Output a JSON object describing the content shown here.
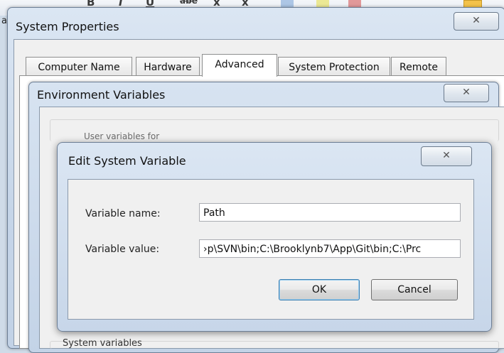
{
  "background": {
    "left_letter": "a",
    "toolbar_glyphs": [
      "B",
      "I",
      "U",
      "abe",
      "x",
      "x"
    ],
    "bottom_text": "System variables"
  },
  "system_properties": {
    "title": "System Properties",
    "close_glyph": "✕",
    "tabs": [
      {
        "label": "Computer Name",
        "active": false
      },
      {
        "label": "Hardware",
        "active": false
      },
      {
        "label": "Advanced",
        "active": true
      },
      {
        "label": "System Protection",
        "active": false
      },
      {
        "label": "Remote",
        "active": false
      }
    ]
  },
  "environment_variables": {
    "title": "Environment Variables",
    "close_glyph": "✕",
    "user_vars_label": "User variables for"
  },
  "edit_system_variable": {
    "title": "Edit System Variable",
    "close_glyph": "✕",
    "variable_name_label": "Variable name:",
    "variable_name_value": "Path",
    "variable_value_label": "Variable value:",
    "variable_value_value": "›p\\SVN\\bin;C:\\Brooklynb7\\App\\Git\\bin;C:\\Prc",
    "ok_label": "OK",
    "cancel_label": "Cancel"
  },
  "colors": {
    "window_frame": "#c5d5e8",
    "dialog_body": "#f0f0f0",
    "default_button_border": "#3c7fb1"
  }
}
